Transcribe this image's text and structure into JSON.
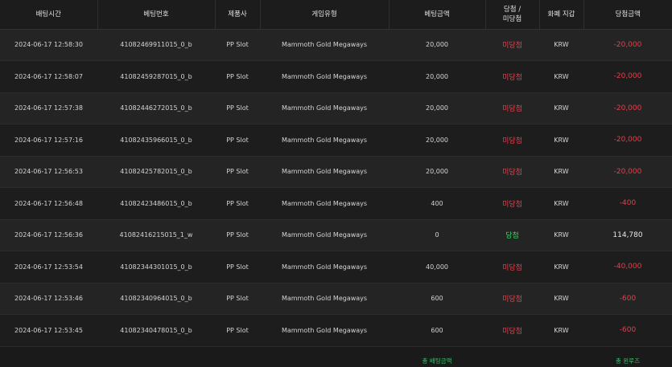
{
  "columns": [
    "배팅시간",
    "베팅번호",
    "제품사",
    "게임유형",
    "베팅금액",
    "당첨 / 미당첨",
    "화폐 지갑",
    "당첨금액"
  ],
  "header_lines": {
    "result_line1": "당첨 /",
    "result_line2": "미당첨"
  },
  "rows": [
    {
      "time": "2024-06-17 12:58:30",
      "bet_id": "41082469911015_0_b",
      "provider": "PP Slot",
      "game": "Mammoth Gold Megaways",
      "bet": "20,000",
      "result": "미당첨",
      "currency": "KRW",
      "win": "-20,000",
      "status": "lose"
    },
    {
      "time": "2024-06-17 12:58:07",
      "bet_id": "41082459287015_0_b",
      "provider": "PP Slot",
      "game": "Mammoth Gold Megaways",
      "bet": "20,000",
      "result": "미당첨",
      "currency": "KRW",
      "win": "-20,000",
      "status": "lose"
    },
    {
      "time": "2024-06-17 12:57:38",
      "bet_id": "41082446272015_0_b",
      "provider": "PP Slot",
      "game": "Mammoth Gold Megaways",
      "bet": "20,000",
      "result": "미당첨",
      "currency": "KRW",
      "win": "-20,000",
      "status": "lose"
    },
    {
      "time": "2024-06-17 12:57:16",
      "bet_id": "41082435966015_0_b",
      "provider": "PP Slot",
      "game": "Mammoth Gold Megaways",
      "bet": "20,000",
      "result": "미당첨",
      "currency": "KRW",
      "win": "-20,000",
      "status": "lose"
    },
    {
      "time": "2024-06-17 12:56:53",
      "bet_id": "41082425782015_0_b",
      "provider": "PP Slot",
      "game": "Mammoth Gold Megaways",
      "bet": "20,000",
      "result": "미당첨",
      "currency": "KRW",
      "win": "-20,000",
      "status": "lose"
    },
    {
      "time": "2024-06-17 12:56:48",
      "bet_id": "41082423486015_0_b",
      "provider": "PP Slot",
      "game": "Mammoth Gold Megaways",
      "bet": "400",
      "result": "미당첨",
      "currency": "KRW",
      "win": "-400",
      "status": "lose"
    },
    {
      "time": "2024-06-17 12:56:36",
      "bet_id": "41082416215015_1_w",
      "provider": "PP Slot",
      "game": "Mammoth Gold Megaways",
      "bet": "0",
      "result": "당첨",
      "currency": "KRW",
      "win": "114,780",
      "status": "win"
    },
    {
      "time": "2024-06-17 12:53:54",
      "bet_id": "41082344301015_0_b",
      "provider": "PP Slot",
      "game": "Mammoth Gold Megaways",
      "bet": "40,000",
      "result": "미당첨",
      "currency": "KRW",
      "win": "-40,000",
      "status": "lose"
    },
    {
      "time": "2024-06-17 12:53:46",
      "bet_id": "41082340964015_0_b",
      "provider": "PP Slot",
      "game": "Mammoth Gold Megaways",
      "bet": "600",
      "result": "미당첨",
      "currency": "KRW",
      "win": "-600",
      "status": "lose"
    },
    {
      "time": "2024-06-17 12:53:45",
      "bet_id": "41082340478015_0_b",
      "provider": "PP Slot",
      "game": "Mammoth Gold Megaways",
      "bet": "600",
      "result": "미당첨",
      "currency": "KRW",
      "win": "-600",
      "status": "lose"
    }
  ],
  "footer": {
    "total_bet_label": "총 배팅금액",
    "total_win_label": "총 윈루즈"
  },
  "colors": {
    "lose": "#e0414f",
    "win": "#3fd06a",
    "footer": "#38c26a"
  }
}
